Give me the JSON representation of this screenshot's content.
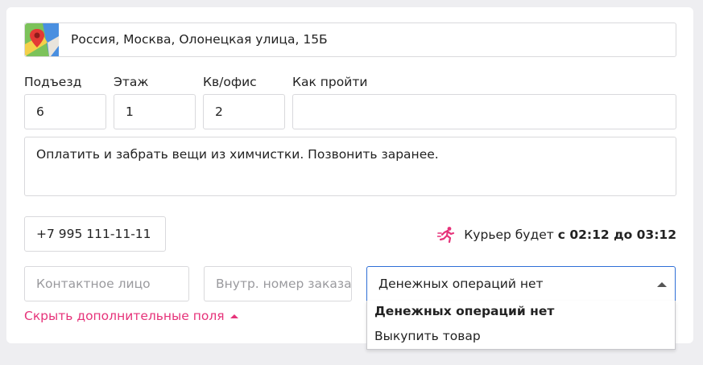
{
  "address": {
    "value": "Россия, Москва, Олонецкая улица, 15Б",
    "icon": "map-pin-icon"
  },
  "labels": {
    "entrance": "Подъезд",
    "floor": "Этаж",
    "apartment": "Кв/офис",
    "how_to_get": "Как пройти"
  },
  "values": {
    "entrance": "6",
    "floor": "1",
    "apartment": "2",
    "how_to_get": ""
  },
  "comment": "Оплатить и забрать вещи из химчистки. Позвонить заранее.",
  "phone": "+7 995 111-11-11",
  "courier": {
    "prefix": "Курьер будет",
    "time": "с 02:12 до 03:12",
    "icon": "running-courier-icon",
    "icon_color": "#e6337a"
  },
  "contact": {
    "placeholder": "Контактное лицо"
  },
  "order_number": {
    "placeholder": "Внутр. номер заказа"
  },
  "payment_select": {
    "selected": "Денежных операций нет",
    "options": [
      "Денежных операций нет",
      "Выкупить товар"
    ]
  },
  "toggle_link": "Скрыть дополнительные поля",
  "colors": {
    "accent": "#e6337a",
    "focus_border": "#2f6fd6"
  }
}
